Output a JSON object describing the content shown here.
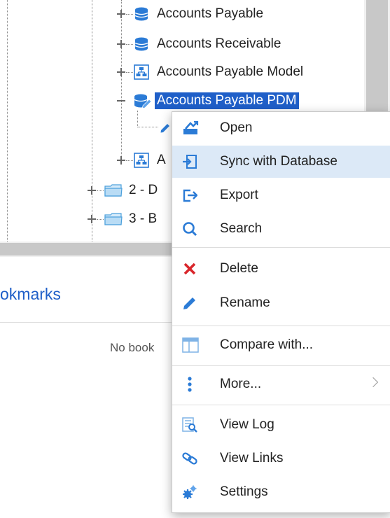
{
  "tree": {
    "items": [
      {
        "label": "Accounts Payable",
        "icon": "database-icon"
      },
      {
        "label": "Accounts Receivable",
        "icon": "database-icon"
      },
      {
        "label": "Accounts Payable Model",
        "icon": "model-icon"
      },
      {
        "label": "Accounts Payable PDM",
        "icon": "database-edit-icon",
        "selected": true
      },
      {
        "label": "A",
        "icon": "model-icon"
      },
      {
        "label": "2 - D",
        "icon": "folder-icon"
      },
      {
        "label": "3 - B",
        "icon": "folder-icon"
      }
    ]
  },
  "bookmarks": {
    "title": "okmarks",
    "empty_text": "No book"
  },
  "context_menu": {
    "items": [
      {
        "label": "Open",
        "icon": "open-icon"
      },
      {
        "label": "Sync with Database",
        "icon": "sync-database-icon",
        "highlighted": true
      },
      {
        "label": "Export",
        "icon": "export-icon"
      },
      {
        "label": "Search",
        "icon": "search-icon"
      },
      {
        "label": "Delete",
        "icon": "delete-icon"
      },
      {
        "label": "Rename",
        "icon": "rename-pencil-icon"
      },
      {
        "label": "Compare with...",
        "icon": "compare-icon"
      },
      {
        "label": "More...",
        "icon": "more-vertical-icon",
        "submenu": true
      },
      {
        "label": "View Log",
        "icon": "view-log-icon"
      },
      {
        "label": "View Links",
        "icon": "view-links-icon"
      },
      {
        "label": "Settings",
        "icon": "settings-gear-icon"
      }
    ]
  },
  "colors": {
    "selection": "#1f5fc8",
    "menu_highlight": "#dce9f7",
    "icon_blue": "#2b7bd6",
    "delete_red": "#d9262b"
  }
}
